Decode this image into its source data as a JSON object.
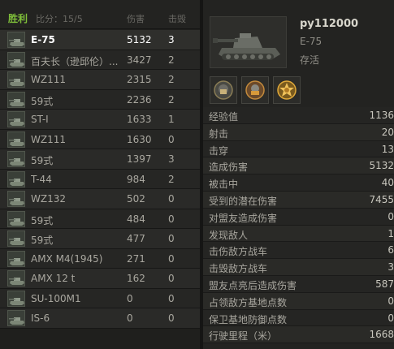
{
  "header": {
    "result": "胜利",
    "score": "比分：15/5",
    "damage_label": "伤害",
    "kills_label": "击毁"
  },
  "players": [
    {
      "tank": "E-75",
      "damage": "5132",
      "kills": "3",
      "me": true
    },
    {
      "tank": "百夫长（逊邱伦）...",
      "damage": "3427",
      "kills": "2"
    },
    {
      "tank": "WZ111",
      "damage": "2315",
      "kills": "2"
    },
    {
      "tank": "59式",
      "damage": "2236",
      "kills": "2"
    },
    {
      "tank": "ST-I",
      "damage": "1633",
      "kills": "1"
    },
    {
      "tank": "WZ111",
      "damage": "1630",
      "kills": "0"
    },
    {
      "tank": "59式",
      "damage": "1397",
      "kills": "3"
    },
    {
      "tank": "T-44",
      "damage": "984",
      "kills": "2"
    },
    {
      "tank": "WZ132",
      "damage": "502",
      "kills": "0"
    },
    {
      "tank": "59式",
      "damage": "484",
      "kills": "0"
    },
    {
      "tank": "59式",
      "damage": "477",
      "kills": "0"
    },
    {
      "tank": "AMX M4(1945)",
      "damage": "271",
      "kills": "0"
    },
    {
      "tank": "AMX 12 t",
      "damage": "162",
      "kills": "0"
    },
    {
      "tank": "SU-100M1",
      "damage": "0",
      "kills": "0"
    },
    {
      "tank": "IS-6",
      "damage": "0",
      "kills": "0"
    }
  ],
  "profile": {
    "player_name": "py112000",
    "tank": "E-75",
    "status": "存活"
  },
  "medals": [
    "medal-icon",
    "medal-icon",
    "medal-icon"
  ],
  "stats": [
    {
      "label": "经验值",
      "value": "1136"
    },
    {
      "label": "射击",
      "value": "20"
    },
    {
      "label": "击穿",
      "value": "13"
    },
    {
      "label": "造成伤害",
      "value": "5132"
    },
    {
      "label": "被击中",
      "value": "40"
    },
    {
      "label": "受到的潜在伤害",
      "value": "7455"
    },
    {
      "label": "对盟友造成伤害",
      "value": "0"
    },
    {
      "label": "发现敌人",
      "value": "1"
    },
    {
      "label": "击伤敌方战车",
      "value": "6"
    },
    {
      "label": "击毁敌方战车",
      "value": "3"
    },
    {
      "label": "盟友点亮后造成伤害",
      "value": "587"
    },
    {
      "label": "占领敌方基地点数",
      "value": "0"
    },
    {
      "label": "保卫基地防御点数",
      "value": "0"
    },
    {
      "label": "行驶里程（米）",
      "value": "1668"
    }
  ],
  "colors": {
    "victory": "#7fbf3a",
    "background": "#1e1e1c"
  }
}
